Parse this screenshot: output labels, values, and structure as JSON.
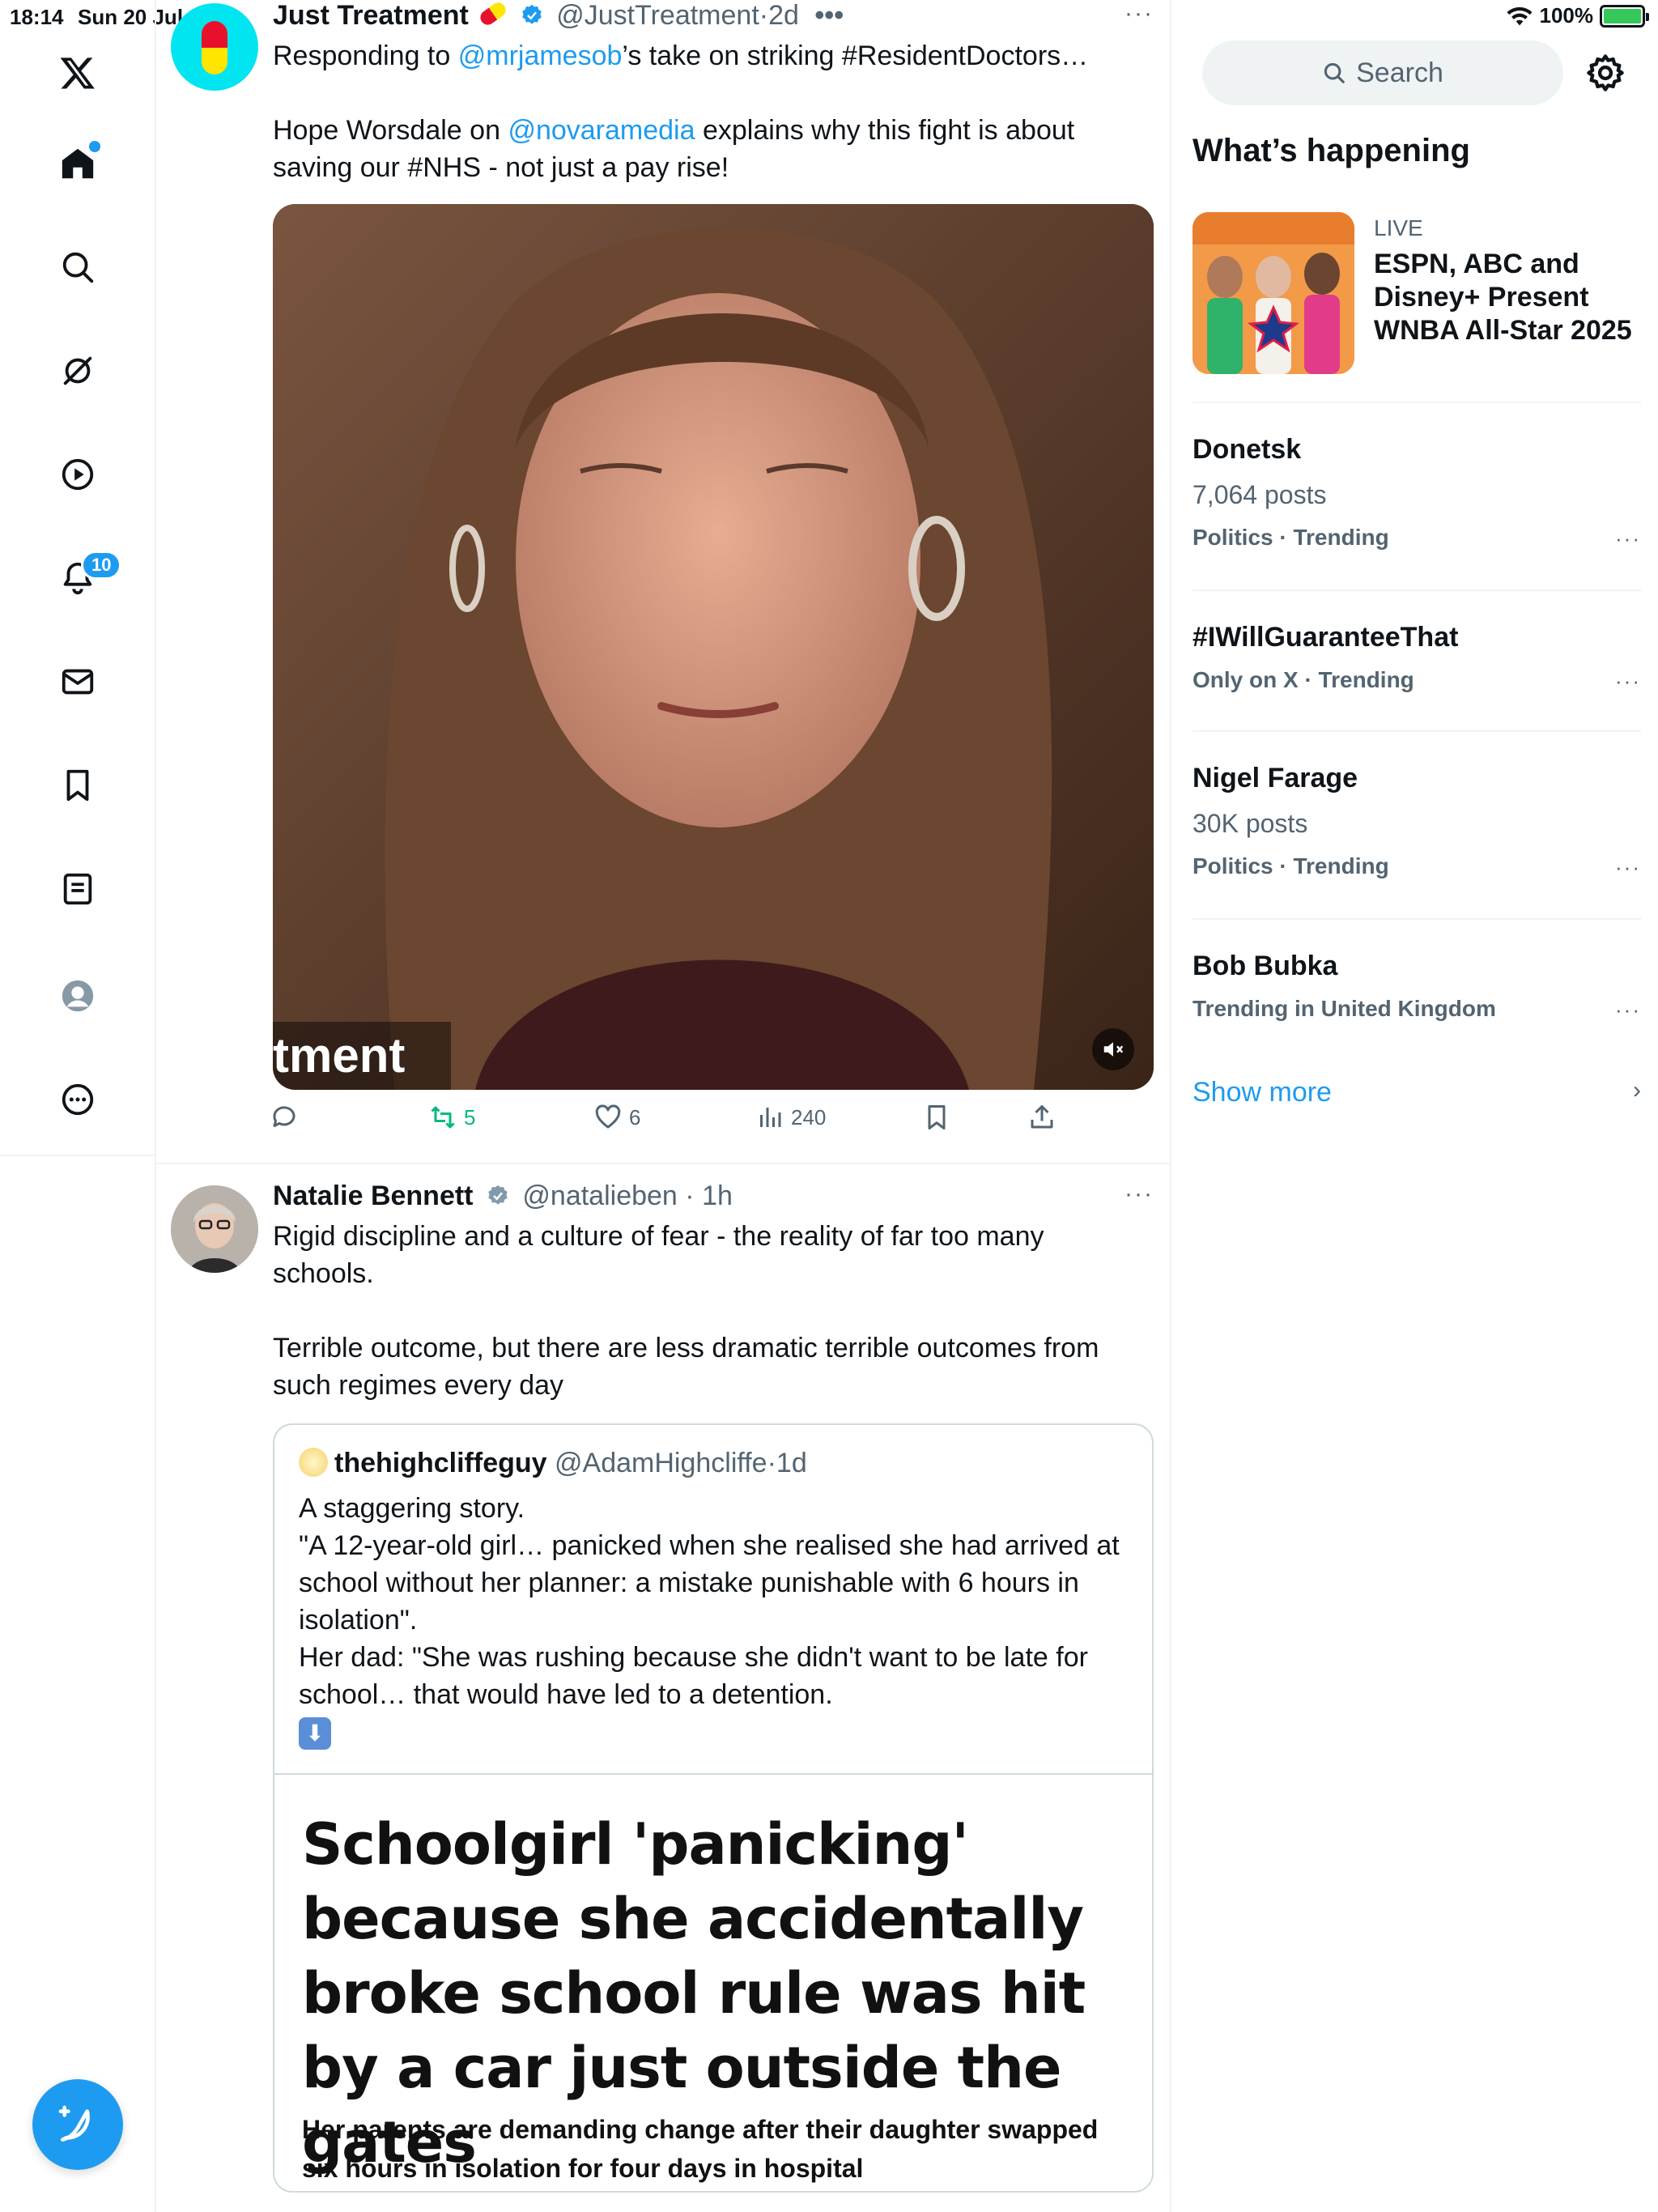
{
  "status_bar": {
    "time": "18:14",
    "date": "Sun 20 Jul",
    "battery": "100%"
  },
  "nav": {
    "notification_count": "10"
  },
  "tweet1": {
    "name": "Just Treatment",
    "handle": "@JustTreatment",
    "time": "2d",
    "line1_prefix": "Responding to ",
    "line1_mention": "@mrjamesob",
    "line1_suffix": "’s take on striking #ResidentDoctors…",
    "line2_prefix": "Hope Worsdale on ",
    "line2_mention": "@novaramedia",
    "line2_suffix": "  explains why this fight is about saving our #NHS - not just a pay rise!",
    "video_caption": "tment",
    "actions": {
      "retweets": "5",
      "likes": "6",
      "views": "240"
    }
  },
  "tweet2": {
    "name": "Natalie Bennett",
    "handle": "@natalieben",
    "time": "1h",
    "para1": "Rigid discipline and a culture of fear - the reality of far too many schools.",
    "para2": "Terrible outcome, but there are less dramatic terrible outcomes from such regimes every day",
    "quote": {
      "name": "thehighcliffeguy",
      "handle": "@AdamHighcliffe",
      "time": "1d",
      "line1": "A staggering story.",
      "line2": "\"A 12-year-old girl… panicked when she realised she had arrived at school without her planner: a mistake punishable with 6 hours in isolation\".",
      "line3": "Her dad: \"She was rushing because she didn't want to be late for school… that would have led to a detention.",
      "card_headline": "Schoolgirl 'panicking' because she accidentally broke school rule was hit by a car just outside the gates",
      "card_sub": "Her parents are demanding change after their daughter swapped six hours in isolation for four days in hospital"
    }
  },
  "sidebar": {
    "search_placeholder": "Search",
    "title": "What’s happening",
    "live": {
      "label": "LIVE",
      "title": "ESPN, ABC and Disney+ Present WNBA All-Star 2025"
    },
    "trends": [
      {
        "name": "Donetsk",
        "count": "7,064 posts",
        "category": "Politics · Trending"
      },
      {
        "name": "#IWillGuaranteeThat",
        "count": "",
        "category": "Only on X · Trending"
      },
      {
        "name": "Nigel Farage",
        "count": "30K posts",
        "category": "Politics · Trending"
      },
      {
        "name": "Bob Bubka",
        "count": "",
        "category": "Trending in United Kingdom"
      }
    ],
    "show_more": "Show more"
  },
  "colors": {
    "accent": "#1d9bf0",
    "text_primary": "#0f1419",
    "text_secondary": "#536471",
    "retweet_green": "#00ba7c"
  }
}
